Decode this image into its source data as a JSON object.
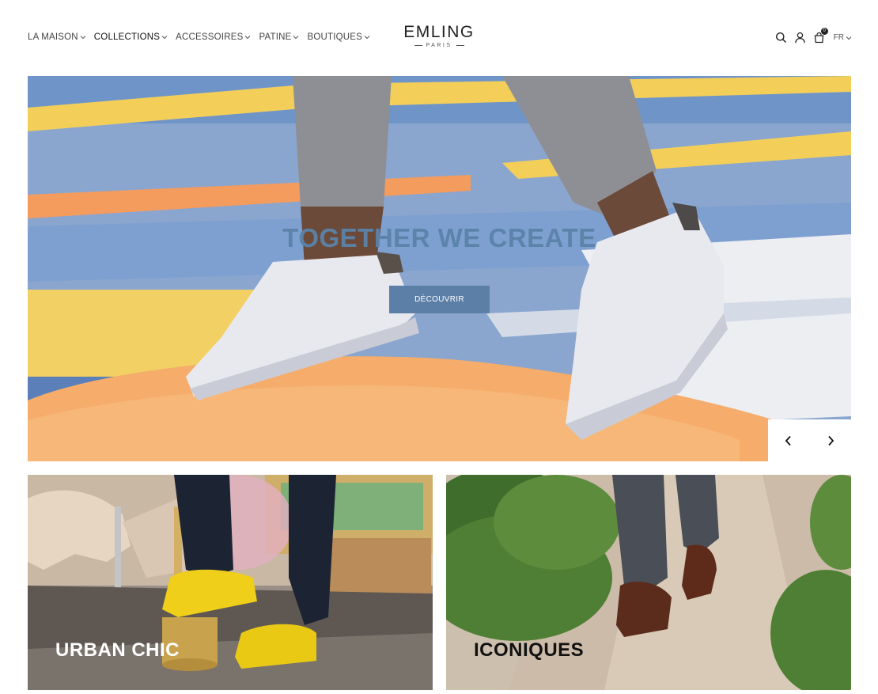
{
  "nav": {
    "items": [
      {
        "label": "LA MAISON",
        "active": false
      },
      {
        "label": "COLLECTIONS",
        "active": true
      },
      {
        "label": "ACCESSOIRES",
        "active": false
      },
      {
        "label": "PATINE",
        "active": false
      },
      {
        "label": "BOUTIQUES",
        "active": false
      }
    ]
  },
  "logo": {
    "name": "EMLING",
    "sub": "PARIS"
  },
  "tools": {
    "icons": [
      "search-icon",
      "user-icon",
      "cart-icon"
    ],
    "cart_count": "0",
    "language": "FR"
  },
  "hero": {
    "title": "TOGETHER WE CREATE",
    "cta": "DÉCOUVRIR",
    "prev_icon": "chevron-left-icon",
    "next_icon": "chevron-right-icon"
  },
  "cards": [
    {
      "title": "URBAN CHIC"
    },
    {
      "title": "ICONIQUES"
    }
  ],
  "colors": {
    "accent": "#5c7fa8",
    "title_blue": "#5b83a9",
    "text": "#222222"
  }
}
